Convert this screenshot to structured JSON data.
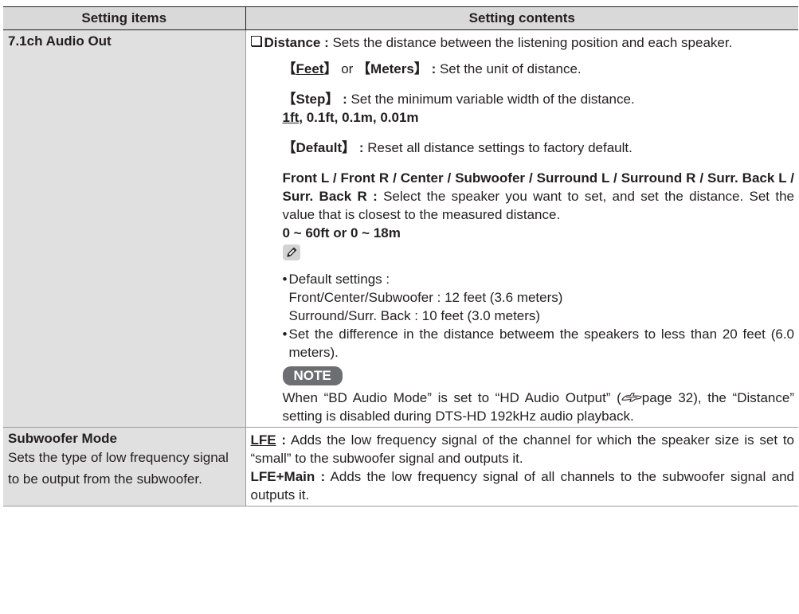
{
  "table": {
    "headers": {
      "col1": "Setting items",
      "col2": "Setting contents"
    },
    "rows": [
      {
        "item_title": "7.1ch Audio Out",
        "distance": {
          "label": "Distance :",
          "description": " Sets the distance between the listening position and each speaker.",
          "unit_opt1": "Feet",
          "unit_or": " or ",
          "unit_opt2": "Meters",
          "unit_colon": " :",
          "unit_desc": " Set the unit of distance.",
          "step_label": "Step",
          "step_colon": " :",
          "step_desc": " Set the minimum variable width of the distance.",
          "step_default_value": "1ft",
          "step_other_values": ", 0.1ft, 0.1m, 0.01m",
          "default_label": "Default",
          "default_colon": " :",
          "default_desc": " Reset all distance settings to factory default.",
          "speakers_label": "Front L / Front R / Center / Subwoofer / Surround L / Surround R / Surr. Back L / Surr. Back R :",
          "speakers_desc": " Select the speaker you want to set, and set the distance. Set the value that is closest to the measured distance.",
          "range": "0 ~ 60ft or 0 ~ 18m",
          "note_icon": "pencil-icon",
          "defaults_heading": "Default settings :",
          "defaults_line1": "Front/Center/Subwoofer : 12 feet (3.6 meters)",
          "defaults_line2": "Surround/Surr. Back : 10 feet (3.0 meters)",
          "difference_note": "Set the difference in the distance betweem the speakers to less than 20 feet (6.0 meters).",
          "note_label": "NOTE",
          "note_text_before": "When “BD Audio Mode” is set to “HD Audio Output” (",
          "note_page_ref": "page 32",
          "note_text_after": "), the “Distance” setting is disabled during DTS-HD 192kHz audio playback."
        }
      },
      {
        "item_title": "Subwoofer Mode",
        "item_desc": "Sets the type of low frequency signal to be output from the subwoofer.",
        "lfe_label": "LFE",
        "lfe_colon": " :",
        "lfe_desc": " Adds the low frequency signal of the channel for which the speaker size is set to “small” to the subwoofer signal and outputs it.",
        "lfe_main_label": "LFE+Main",
        "lfe_main_colon": " :",
        "lfe_main_desc": " Adds the low frequency signal of all channels to the subwoofer signal and outputs it."
      }
    ]
  }
}
